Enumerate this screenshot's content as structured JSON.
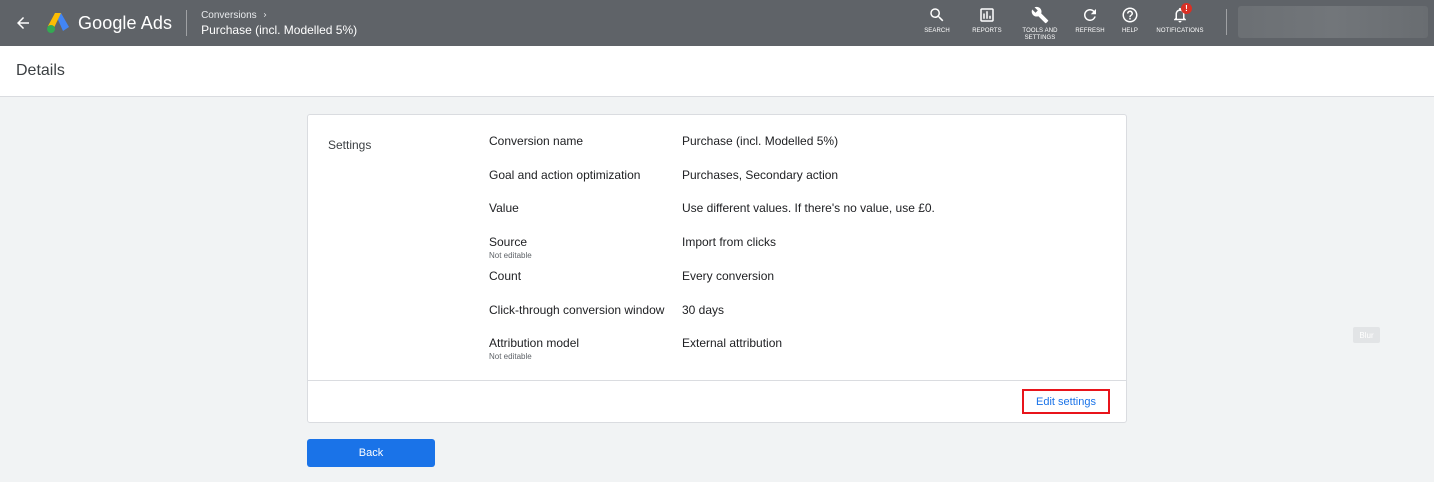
{
  "topbar": {
    "brand": "Google Ads",
    "breadcrumb_parent": "Conversions",
    "breadcrumb_current": "Purchase (incl. Modelled 5%)",
    "tools": {
      "search": "SEARCH",
      "reports": "REPORTS",
      "tools_line1": "TOOLS AND",
      "tools_line2": "SETTINGS",
      "refresh": "REFRESH",
      "help": "HELP",
      "notifications": "NOTIFICATIONS"
    },
    "notification_badge": "!"
  },
  "page": {
    "title": "Details"
  },
  "settings": {
    "section_label": "Settings",
    "rows": [
      {
        "name": "Conversion name",
        "sub": "",
        "value": "Purchase (incl. Modelled 5%)"
      },
      {
        "name": "Goal and action optimization",
        "sub": "",
        "value": "Purchases, Secondary action"
      },
      {
        "name": "Value",
        "sub": "",
        "value": "Use different values. If there's no value, use £0."
      },
      {
        "name": "Source",
        "sub": "Not editable",
        "value": "Import from clicks"
      },
      {
        "name": "Count",
        "sub": "",
        "value": "Every conversion"
      },
      {
        "name": "Click-through conversion window",
        "sub": "",
        "value": "30 days"
      },
      {
        "name": "Attribution model",
        "sub": "Not editable",
        "value": "External attribution"
      }
    ],
    "edit_label": "Edit settings"
  },
  "back_label": "Back",
  "blur_label": "Blur",
  "colors": {
    "topbar": "#5f6368",
    "accent": "#1a73e8",
    "highlight": "#e8141b"
  }
}
